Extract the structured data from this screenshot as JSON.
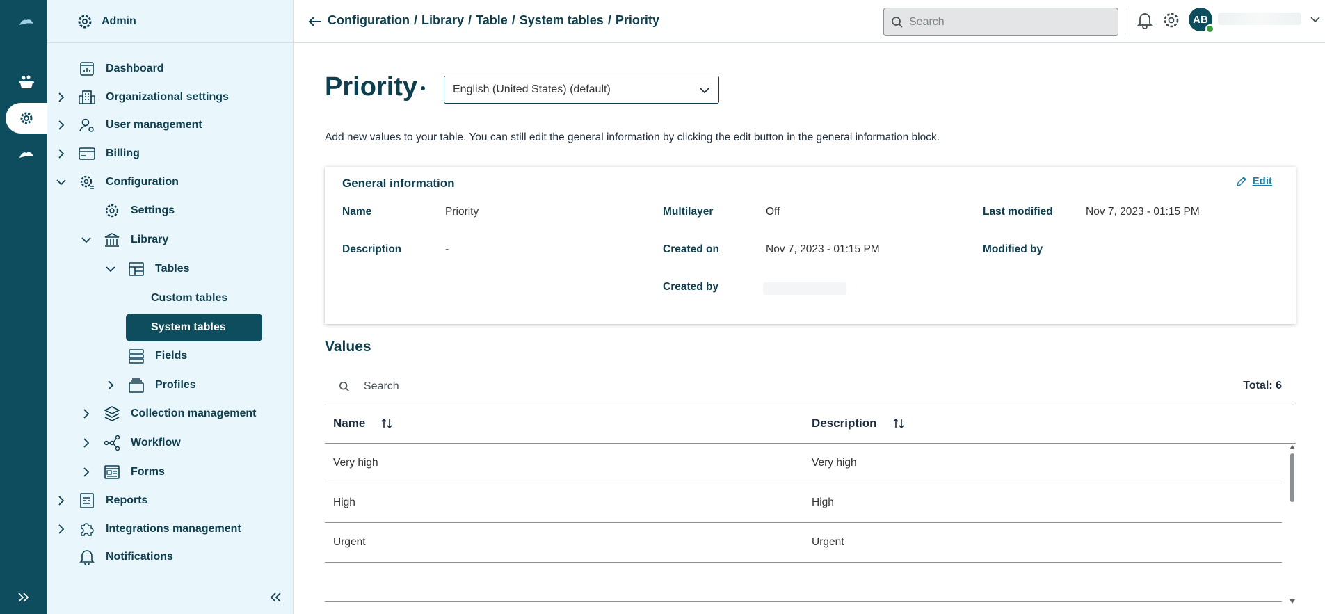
{
  "header": {
    "breadcrumb": [
      "Configuration",
      "Library",
      "Table",
      "System tables",
      "Priority"
    ],
    "search_placeholder": "Search",
    "avatar_initials": "AB"
  },
  "sidebar": {
    "title": "Admin",
    "items": [
      {
        "label": "Dashboard",
        "icon": "dashboard-icon"
      },
      {
        "label": "Organizational settings",
        "icon": "building-icon"
      },
      {
        "label": "User management",
        "icon": "user-gear-icon"
      },
      {
        "label": "Billing",
        "icon": "card-icon"
      },
      {
        "label": "Configuration",
        "icon": "config-icon"
      },
      {
        "label": "Settings",
        "icon": "gear-icon"
      },
      {
        "label": "Library",
        "icon": "library-icon"
      },
      {
        "label": "Tables",
        "icon": "table-icon"
      },
      {
        "label": "Custom tables"
      },
      {
        "label": "System tables"
      },
      {
        "label": "Fields",
        "icon": "fields-icon"
      },
      {
        "label": "Profiles",
        "icon": "profiles-icon"
      },
      {
        "label": "Collection management",
        "icon": "layers-icon"
      },
      {
        "label": "Workflow",
        "icon": "workflow-icon"
      },
      {
        "label": "Forms",
        "icon": "forms-icon"
      },
      {
        "label": "Reports",
        "icon": "reports-icon"
      },
      {
        "label": "Integrations management",
        "icon": "puzzle-icon"
      },
      {
        "label": "Notifications",
        "icon": "bell-icon"
      }
    ]
  },
  "main": {
    "title": "Priority",
    "language": "English (United States) (default)",
    "intro": "Add new values to your table. You can still edit the general information by clicking the edit button in the general information block.",
    "general": {
      "title": "General information",
      "edit_label": "Edit",
      "name_label": "Name",
      "name_value": "Priority",
      "description_label": "Description",
      "description_value": "-",
      "multilayer_label": "Multilayer",
      "multilayer_value": "Off",
      "created_on_label": "Created on",
      "created_on_value": "Nov 7, 2023 - 01:15 PM",
      "created_by_label": "Created by",
      "last_modified_label": "Last modified",
      "last_modified_value": "Nov 7, 2023 - 01:15 PM",
      "modified_by_label": "Modified by"
    },
    "values": {
      "title": "Values",
      "search_placeholder": "Search",
      "total": "Total: 6",
      "columns": [
        "Name",
        "Description"
      ],
      "rows": [
        {
          "name": "Very high",
          "description": "Very high"
        },
        {
          "name": "High",
          "description": "High"
        },
        {
          "name": "Urgent",
          "description": "Urgent"
        },
        {
          "name": "",
          "description": ""
        }
      ]
    }
  },
  "colors": {
    "brand": "#0e4d5e",
    "sidebar_bg": "#e9f6fb",
    "link": "#1d7fa5"
  }
}
